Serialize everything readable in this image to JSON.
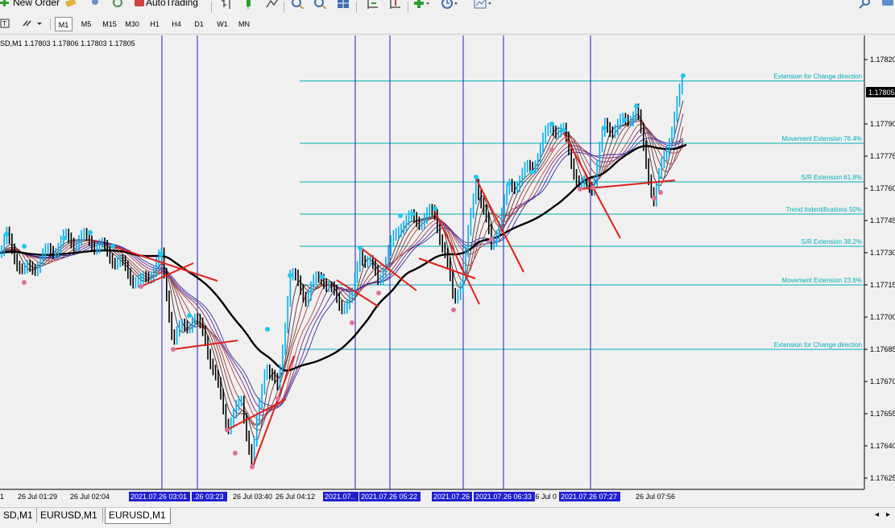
{
  "toolbar": {
    "new_order_label": "New Order",
    "autotrading_label": "AutoTrading"
  },
  "timeframes": [
    {
      "label": "M1",
      "active": true
    },
    {
      "label": "M5",
      "active": false
    },
    {
      "label": "M15",
      "active": false
    },
    {
      "label": "M30",
      "active": false
    },
    {
      "label": "H1",
      "active": false
    },
    {
      "label": "H4",
      "active": false
    },
    {
      "label": "D1",
      "active": false
    },
    {
      "label": "W1",
      "active": false
    },
    {
      "label": "MN",
      "active": false
    }
  ],
  "chart": {
    "info": "SD,M1  1.17803 1.17806 1.17803 1.17805",
    "current_price": "1.17805",
    "price_labels": [
      "1.17820",
      "1.17790",
      "1.17775",
      "1.17760",
      "1.17745",
      "1.17730",
      "1.17715",
      "1.17700",
      "1.17685",
      "1.17670",
      "1.17655",
      "1.17640",
      "1.17625"
    ],
    "time_labels": [
      "1",
      "26 Jul 01:29",
      "26 Jul 02:04",
      "26 Jul 03:40",
      "26 Jul 04:12",
      "26 Jul 07:56"
    ],
    "time_labels_highlighted": [
      "2021.07.26 03:01",
      ".26 03:23",
      "2021.07..",
      "2021.07.26 05:22",
      "2021.07.26",
      "2021.07.26 06:33",
      "2021.07.26 07:27"
    ],
    "time_fragments": [
      ":6 Jul 0"
    ],
    "fib_levels": [
      {
        "label": "Extension for Change direction",
        "price": 1.1781
      },
      {
        "label": "Movement Extension  76.4%",
        "price": 1.17781
      },
      {
        "label": "S/R Extension   61.8%",
        "price": 1.17763
      },
      {
        "label": "Trend Indentifications  50%",
        "price": 1.17748
      },
      {
        "label": "S/R Extension   38.2%",
        "price": 1.17733
      },
      {
        "label": "Movement Extension   23.6%",
        "price": 1.17715
      },
      {
        "label": "Extension for Change direction",
        "price": 1.17685
      }
    ],
    "colors": {
      "background": "#f0f0f0",
      "bull_candle": "#00aeef",
      "bear_candle": "#000000",
      "fib_line": "#00aeb8",
      "vertical_line": "#1f1fb4",
      "trend_line": "#e0201a",
      "ma_black": "#000000",
      "highlight_label_bg": "#1f1fd0"
    }
  },
  "tabs": [
    {
      "label": "SD,M1",
      "active": false
    },
    {
      "label": "EURUSD,M1",
      "active": false
    },
    {
      "label": "EURUSD,M1",
      "active": true
    }
  ]
}
